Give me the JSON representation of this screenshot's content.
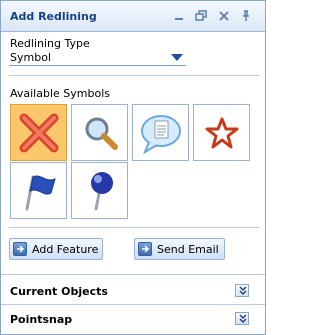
{
  "window": {
    "title": "Add Redlining",
    "controls": [
      "minimize-icon",
      "restore-icon",
      "close-icon",
      "pin-icon"
    ]
  },
  "redlining_type": {
    "label": "Redlining Type",
    "value": "Symbol"
  },
  "available_symbols": {
    "label": "Available Symbols",
    "items": [
      {
        "icon": "red-x-icon",
        "selected": true
      },
      {
        "icon": "magnifier-icon",
        "selected": false
      },
      {
        "icon": "speech-bubble-document-icon",
        "selected": false
      },
      {
        "icon": "star-icon",
        "selected": false
      },
      {
        "icon": "flag-icon",
        "selected": false
      },
      {
        "icon": "pushpin-icon",
        "selected": false
      }
    ]
  },
  "actions": {
    "add_feature": "Add Feature",
    "send_email": "Send Email"
  },
  "sections": {
    "current_objects": "Current Objects",
    "pointsnap": "Pointsnap"
  },
  "colors": {
    "title_text": "#15428b",
    "selected_tile": "#fcc76a",
    "border": "#8aa6c8"
  }
}
